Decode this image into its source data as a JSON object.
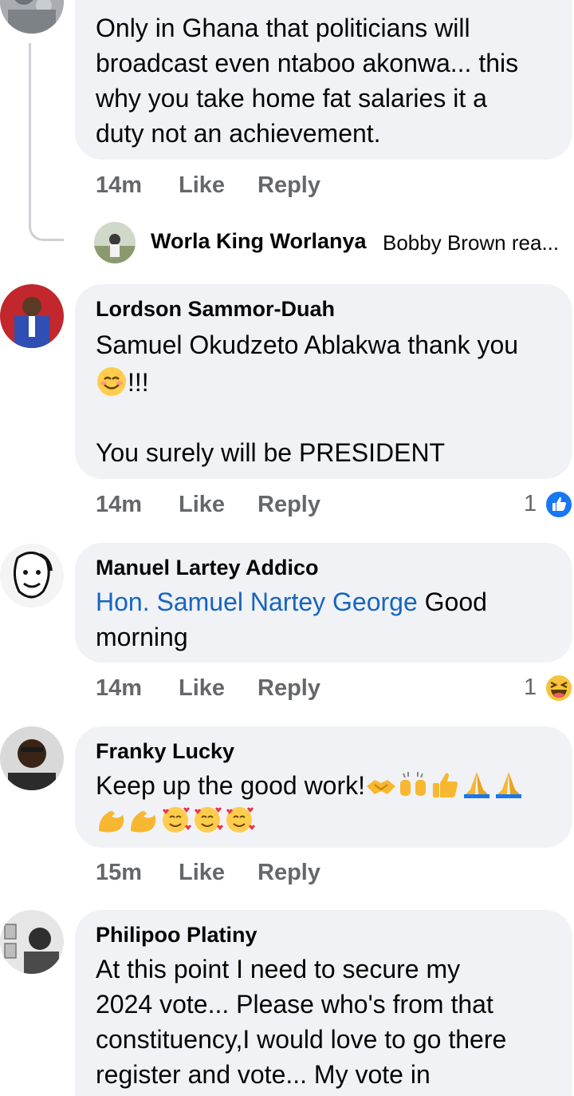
{
  "comments": [
    {
      "author": "",
      "lines": [
        "Only in Ghana that politicians will",
        "broadcast even ntaboo akonwa... this",
        "why you take home fat salaries it a",
        "duty not an achievement."
      ],
      "time": "14m",
      "like_label": "Like",
      "reply_label": "Reply",
      "reply_preview": {
        "name": "Worla King Worlanya",
        "text": "Bobby Brown rea..."
      }
    },
    {
      "author": "Lordson Sammor-Duah",
      "line1": "Samuel Okudzeto Ablakwa thank you",
      "line2_text": "!!!",
      "line3": "You surely will be PRESIDENT",
      "time": "14m",
      "like_label": "Like",
      "reply_label": "Reply",
      "reaction_count": "1",
      "reaction_icon": "like-icon"
    },
    {
      "author": "Manuel Lartey Addico",
      "mention": "Hon. Samuel Nartey George",
      "line1_rest": " Good",
      "line2": "morning",
      "time": "14m",
      "like_label": "Like",
      "reply_label": "Reply",
      "reaction_count": "1",
      "reaction_icon": "haha-icon"
    },
    {
      "author": "Franky Lucky",
      "line1": "Keep up the good work!",
      "emojis_line1": [
        "handshake",
        "raising-hands",
        "thumbs-up",
        "folded-hands",
        "folded-hands"
      ],
      "emojis_line2": [
        "flexed-biceps",
        "flexed-biceps",
        "smiling-face-with-hearts",
        "smiling-face-with-hearts",
        "smiling-face-with-hearts"
      ],
      "time": "15m",
      "like_label": "Like",
      "reply_label": "Reply"
    },
    {
      "author": "Philipoo Platiny",
      "lines": [
        "At this point I need to secure my",
        "2024 vote... Please who's from that",
        "constituency,I would love to go there",
        "register and vote... My vote in"
      ]
    }
  ],
  "colors": {
    "bubble": "#f0f2f5",
    "secondary_text": "#65676b",
    "mention": "#1665c0",
    "like_blue": "#1877f2"
  }
}
